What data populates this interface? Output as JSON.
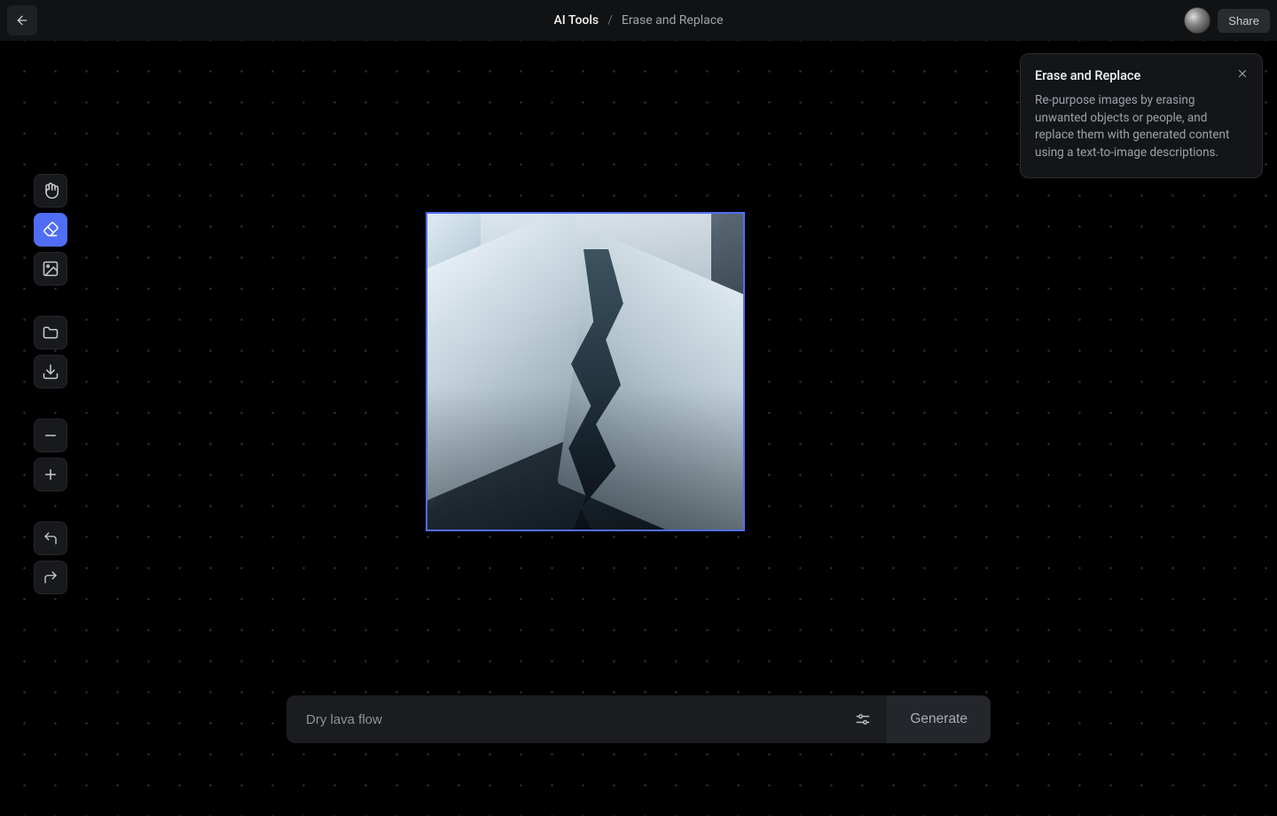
{
  "header": {
    "breadcrumb_root": "AI Tools",
    "breadcrumb_separator": "/",
    "breadcrumb_leaf": "Erase and Replace",
    "share_label": "Share"
  },
  "toolbar": {
    "tools": [
      {
        "name": "pan-tool",
        "icon": "hand-icon",
        "active": false
      },
      {
        "name": "erase-tool",
        "icon": "eraser-icon",
        "active": true
      },
      {
        "name": "image-tool",
        "icon": "image-icon",
        "active": false
      }
    ],
    "file_tools": [
      {
        "name": "folder-tool",
        "icon": "folder-icon"
      },
      {
        "name": "download-tool",
        "icon": "download-icon"
      }
    ],
    "zoom_tools": [
      {
        "name": "zoom-out-tool",
        "icon": "minus-icon"
      },
      {
        "name": "zoom-in-tool",
        "icon": "plus-icon"
      }
    ],
    "history_tools": [
      {
        "name": "undo-tool",
        "icon": "undo-icon"
      },
      {
        "name": "redo-tool",
        "icon": "redo-icon"
      }
    ]
  },
  "info_panel": {
    "title": "Erase and Replace",
    "description": "Re-purpose images by erasing unwanted objects or people, and replace them with generated content using a text-to-image descriptions."
  },
  "prompt": {
    "placeholder": "Dry lava flow",
    "value": "",
    "generate_label": "Generate"
  },
  "canvas": {
    "image_alt": "aerial view of snowy mountain valley with a dark glacial river running through the center",
    "accent_color": "#4f6ef5"
  }
}
